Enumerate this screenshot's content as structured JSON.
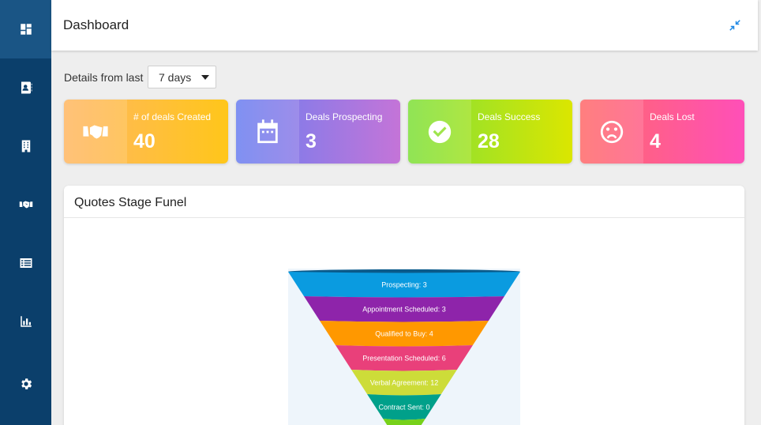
{
  "sidebar": {
    "items": [
      {
        "icon": "dashboard-icon",
        "active": true
      },
      {
        "icon": "contacts-icon",
        "active": false
      },
      {
        "icon": "building-icon",
        "active": false
      },
      {
        "icon": "handshake-icon",
        "active": false
      },
      {
        "icon": "list-icon",
        "active": false
      },
      {
        "icon": "bar-chart-icon",
        "active": false
      },
      {
        "icon": "gear-icon",
        "active": false
      }
    ]
  },
  "header": {
    "title": "Dashboard",
    "collapse_icon": "collapse-icon"
  },
  "filter": {
    "label": "Details from last",
    "selected": "7 days"
  },
  "cards": [
    {
      "label": "# of deals Created",
      "value": "40",
      "icon": "handshake-icon"
    },
    {
      "label": "Deals Prospecting",
      "value": "3",
      "icon": "calendar-icon"
    },
    {
      "label": "Deals Success",
      "value": "28",
      "icon": "check-circle-icon"
    },
    {
      "label": "Deals Lost",
      "value": "4",
      "icon": "sad-face-icon"
    }
  ],
  "panel": {
    "title": "Quotes Stage Funel"
  },
  "chart_data": {
    "type": "funnel",
    "categories": [
      "Prospecting",
      "Appointment Scheduled",
      "Qualified to Buy",
      "Presentation Scheduled",
      "Verbal Agreement",
      "Contract Sent",
      ""
    ],
    "values": [
      3,
      3,
      4,
      6,
      12,
      0,
      null
    ],
    "labels": [
      "Prospecting: 3",
      "Appointment Scheduled: 3",
      "Qualified to Buy: 4",
      "Presentation Scheduled: 6",
      "Verbal Agreement: 12",
      "Contract Sent: 0",
      ""
    ],
    "colors": [
      "#0a9be0",
      "#8e24aa",
      "#ff9800",
      "#e9407a",
      "#cddc39",
      "#00a08a",
      "#76d11a"
    ]
  }
}
